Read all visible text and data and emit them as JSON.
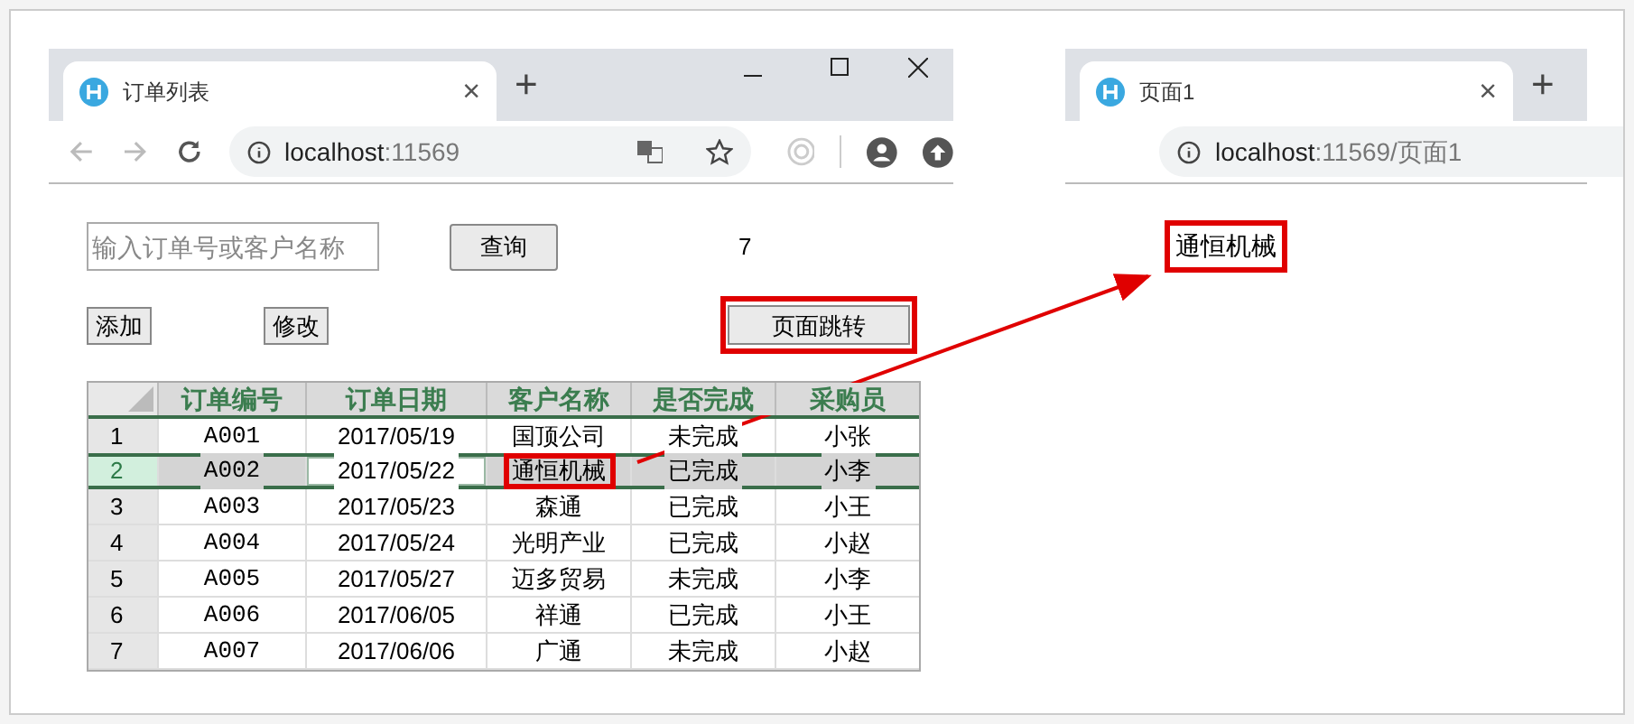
{
  "windows": [
    {
      "tab": {
        "title": "订单列表",
        "close": "×"
      },
      "new_tab": "+",
      "address": {
        "host": "localhost",
        "path": ":11569"
      },
      "kind": "list"
    },
    {
      "tab": {
        "title": "页面1",
        "close": "×"
      },
      "new_tab": "+",
      "address": {
        "host": "localhost",
        "path": ":11569/页面1"
      },
      "kind": "detail"
    }
  ],
  "list_page": {
    "search": {
      "placeholder": "输入订单号或客户名称"
    },
    "query_button": "查询",
    "count": "7",
    "buttons": [
      {
        "label": "添加",
        "highlighted": false
      },
      {
        "label": "修改",
        "highlighted": false
      },
      {
        "label": "页面跳转",
        "highlighted": true
      }
    ],
    "table": {
      "columns": [
        "订单编号",
        "订单日期",
        "客户名称",
        "是否完成",
        "采购员"
      ],
      "rows": [
        {
          "number": "1",
          "selected": false,
          "cells": [
            {
              "text": "A001",
              "active": false,
              "highlighted": false
            },
            {
              "text": "2017/05/19",
              "active": false,
              "highlighted": false
            },
            {
              "text": "国顶公司",
              "active": false,
              "highlighted": false
            },
            {
              "text": "未完成",
              "active": false,
              "highlighted": false
            },
            {
              "text": "小张",
              "active": false,
              "highlighted": false
            }
          ]
        },
        {
          "number": "2",
          "selected": true,
          "cells": [
            {
              "text": "A002",
              "active": false,
              "highlighted": false
            },
            {
              "text": "2017/05/22",
              "active": true,
              "highlighted": false
            },
            {
              "text": "通恒机械",
              "active": false,
              "highlighted": true
            },
            {
              "text": "已完成",
              "active": false,
              "highlighted": false
            },
            {
              "text": "小李",
              "active": false,
              "highlighted": false
            }
          ]
        },
        {
          "number": "3",
          "selected": false,
          "cells": [
            {
              "text": "A003",
              "active": false,
              "highlighted": false
            },
            {
              "text": "2017/05/23",
              "active": false,
              "highlighted": false
            },
            {
              "text": "森通",
              "active": false,
              "highlighted": false
            },
            {
              "text": "已完成",
              "active": false,
              "highlighted": false
            },
            {
              "text": "小王",
              "active": false,
              "highlighted": false
            }
          ]
        },
        {
          "number": "4",
          "selected": false,
          "cells": [
            {
              "text": "A004",
              "active": false,
              "highlighted": false
            },
            {
              "text": "2017/05/24",
              "active": false,
              "highlighted": false
            },
            {
              "text": "光明产业",
              "active": false,
              "highlighted": false
            },
            {
              "text": "已完成",
              "active": false,
              "highlighted": false
            },
            {
              "text": "小赵",
              "active": false,
              "highlighted": false
            }
          ]
        },
        {
          "number": "5",
          "selected": false,
          "cells": [
            {
              "text": "A005",
              "active": false,
              "highlighted": false
            },
            {
              "text": "2017/05/27",
              "active": false,
              "highlighted": false
            },
            {
              "text": "迈多贸易",
              "active": false,
              "highlighted": false
            },
            {
              "text": "未完成",
              "active": false,
              "highlighted": false
            },
            {
              "text": "小李",
              "active": false,
              "highlighted": false
            }
          ]
        },
        {
          "number": "6",
          "selected": false,
          "cells": [
            {
              "text": "A006",
              "active": false,
              "highlighted": false
            },
            {
              "text": "2017/06/05",
              "active": false,
              "highlighted": false
            },
            {
              "text": "祥通",
              "active": false,
              "highlighted": false
            },
            {
              "text": "已完成",
              "active": false,
              "highlighted": false
            },
            {
              "text": "小王",
              "active": false,
              "highlighted": false
            }
          ]
        },
        {
          "number": "7",
          "selected": false,
          "cells": [
            {
              "text": "A007",
              "active": false,
              "highlighted": false
            },
            {
              "text": "2017/06/06",
              "active": false,
              "highlighted": false
            },
            {
              "text": "广通",
              "active": false,
              "highlighted": false
            },
            {
              "text": "未完成",
              "active": false,
              "highlighted": false
            },
            {
              "text": "小赵",
              "active": false,
              "highlighted": false
            }
          ]
        }
      ]
    }
  },
  "detail_page": {
    "text": "通恒机械",
    "highlighted": true
  }
}
